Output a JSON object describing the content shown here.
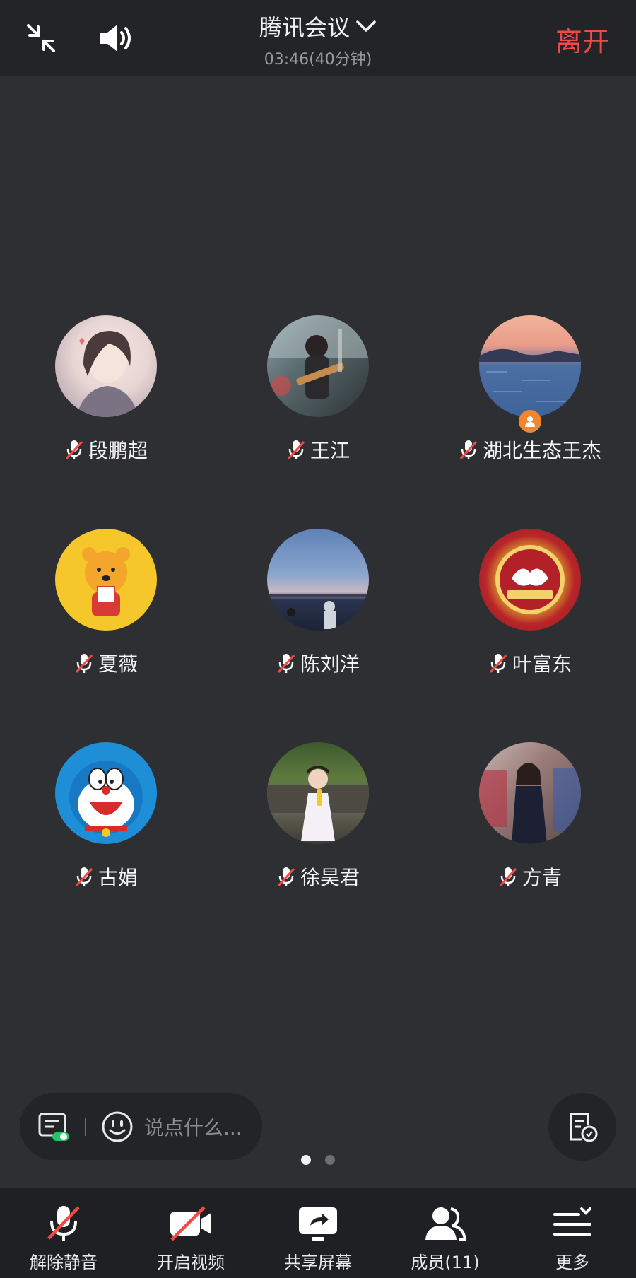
{
  "header": {
    "title": "腾讯会议",
    "timer": "03:46(40分钟)",
    "leave_label": "离开"
  },
  "participants": [
    {
      "name": "段鹏超",
      "avatar": "girl-illustration",
      "muted": true
    },
    {
      "name": "王江",
      "avatar": "guitarist-photo",
      "muted": true
    },
    {
      "name": "湖北生态王杰",
      "avatar": "sea-sunset",
      "muted": true,
      "host": true
    },
    {
      "name": "夏薇",
      "avatar": "pooh-bear",
      "muted": true
    },
    {
      "name": "陈刘洋",
      "avatar": "lake-dusk",
      "muted": true
    },
    {
      "name": "叶富东",
      "avatar": "volunteer-medal",
      "muted": true
    },
    {
      "name": "古娟",
      "avatar": "doraemon",
      "muted": true
    },
    {
      "name": "徐昊君",
      "avatar": "child-photo",
      "muted": true
    },
    {
      "name": "方青",
      "avatar": "woman-photo",
      "muted": true
    }
  ],
  "chat": {
    "placeholder": "说点什么..."
  },
  "pager": {
    "pages": 2,
    "current": 1
  },
  "toolbar": {
    "unmute_label": "解除静音",
    "video_label": "开启视频",
    "share_label": "共享屏幕",
    "members_label": "成员(11)",
    "more_label": "更多"
  },
  "colors": {
    "accent_red": "#f04b47",
    "host_orange": "#f2862e",
    "background": "#2e2f33"
  }
}
